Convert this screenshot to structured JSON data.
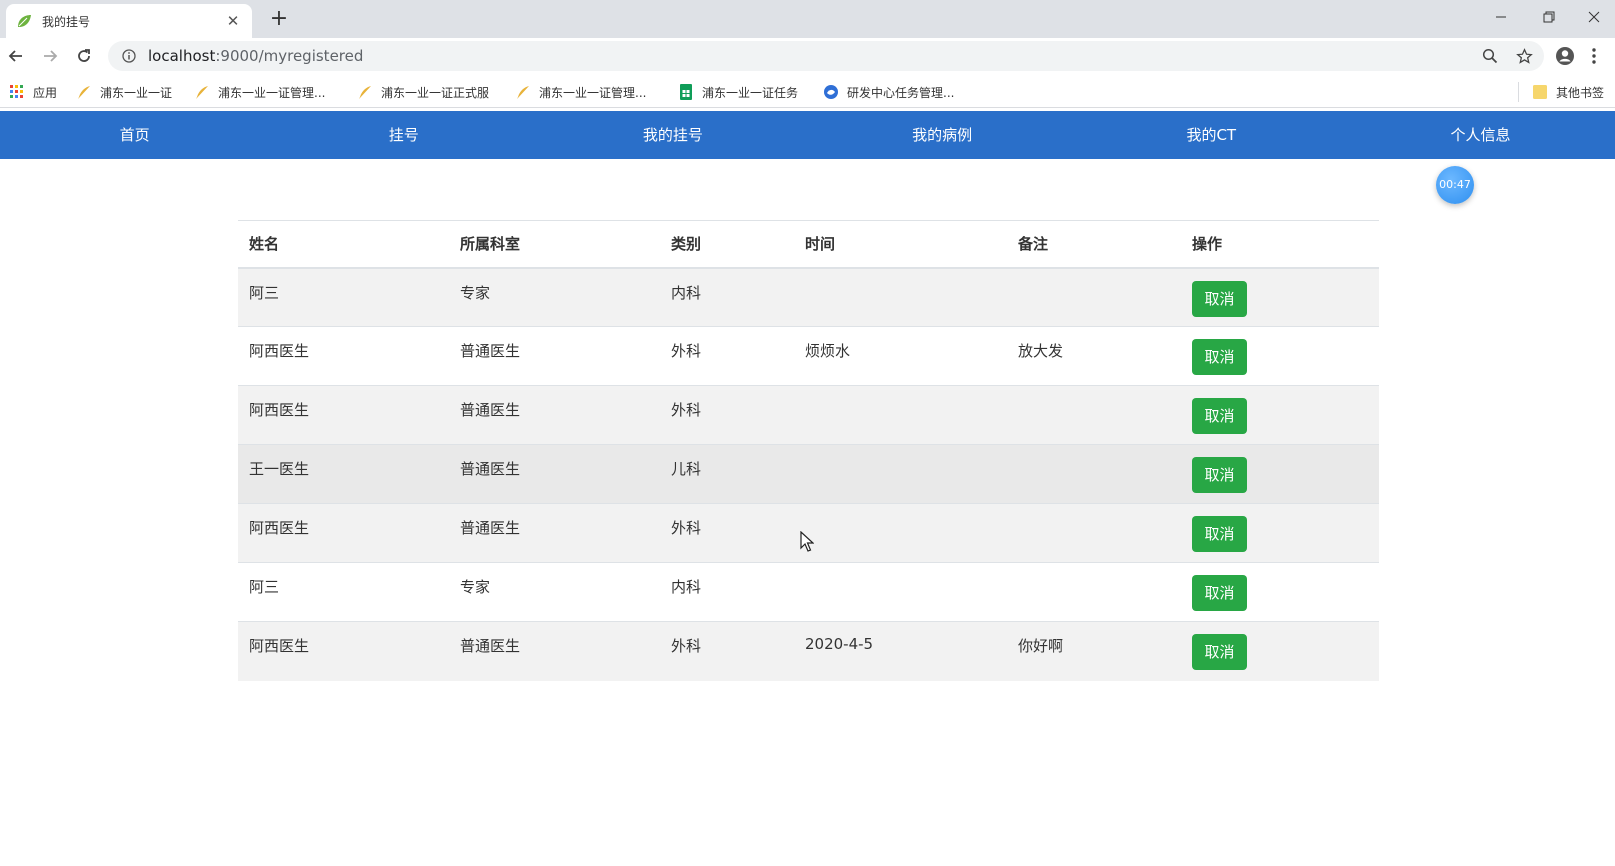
{
  "browser": {
    "tab_title": "我的挂号",
    "url_host": "localhost",
    "url_rest": ":9000/myregistered",
    "bookmarks": [
      {
        "label": "应用",
        "icon": "apps-grid-icon"
      },
      {
        "label": "浦东一业一证",
        "icon": "feather-icon"
      },
      {
        "label": "浦东一业一证管理...",
        "icon": "feather-icon"
      },
      {
        "label": "浦东一业一证正式服",
        "icon": "feather-icon"
      },
      {
        "label": "浦东一业一证管理...",
        "icon": "feather-icon"
      },
      {
        "label": "浦东一业一证任务",
        "icon": "sheets-icon"
      },
      {
        "label": "研发中心任务管理...",
        "icon": "globe-icon"
      }
    ],
    "other_bookmarks": "其他书签"
  },
  "nav": {
    "items": [
      "首页",
      "挂号",
      "我的挂号",
      "我的病例",
      "我的CT",
      "个人信息"
    ]
  },
  "timer": "00:47",
  "table": {
    "headers": [
      "姓名",
      "所属科室",
      "类别",
      "时间",
      "备注",
      "操作"
    ],
    "cancel_label": "取消",
    "rows": [
      {
        "name": "阿三",
        "dept": "专家",
        "category": "内科",
        "time": "",
        "note": ""
      },
      {
        "name": "阿西医生",
        "dept": "普通医生",
        "category": "外科",
        "time": "烦烦水",
        "note": "放大发"
      },
      {
        "name": "阿西医生",
        "dept": "普通医生",
        "category": "外科",
        "time": "",
        "note": ""
      },
      {
        "name": "王一医生",
        "dept": "普通医生",
        "category": "儿科",
        "time": "",
        "note": ""
      },
      {
        "name": "阿西医生",
        "dept": "普通医生",
        "category": "外科",
        "time": "",
        "note": ""
      },
      {
        "name": "阿三",
        "dept": "专家",
        "category": "内科",
        "time": "",
        "note": ""
      },
      {
        "name": "阿西医生",
        "dept": "普通医生",
        "category": "外科",
        "time": "2020-4-5",
        "note": "你好啊"
      }
    ]
  },
  "colors": {
    "nav_bg": "#2a6fc9",
    "cancel_btn": "#28a745",
    "timer": "#2e8ff0"
  }
}
